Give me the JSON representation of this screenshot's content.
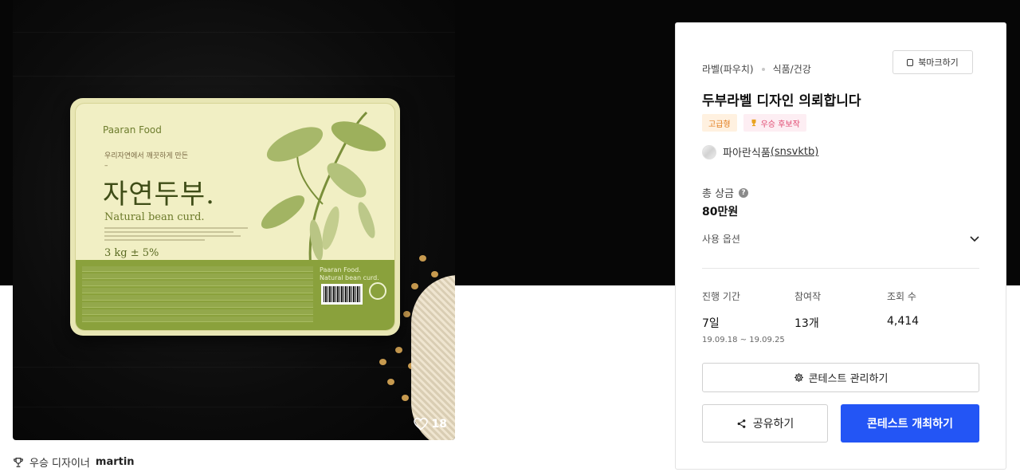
{
  "product_image": {
    "package": {
      "brand": "Paaran Food",
      "subtitle": "우리자연에서 깨끗하게 만든 –",
      "title": "자연두부.",
      "english": "Natural bean curd.",
      "weight": "3 kg ± 5%",
      "band_brand_line1": "Paaran Food.",
      "band_brand_line2": "Natural bean curd."
    },
    "like_count": "18",
    "like_icon": "heart-icon"
  },
  "winner": {
    "icon": "trophy-icon",
    "prefix": "우승 디자이너",
    "name": "martin"
  },
  "card": {
    "categories": [
      "라벨(파우치)",
      "식품/건강"
    ],
    "bookmark_label": "북마크하기",
    "title": "두부라벨 디자인 의뢰합니다",
    "badges": {
      "premium": "고급형",
      "candidate": "우승 후보작"
    },
    "owner": {
      "name": "파아란식품",
      "id": "(snsvktb)"
    },
    "prize": {
      "label": "총 상금",
      "help": "?",
      "value": "80만원"
    },
    "usage_label": "사용 옵션",
    "stats": {
      "period": {
        "label": "진행 기간",
        "value": "7일",
        "dates": "19.09.18 ~ 19.09.25"
      },
      "entries": {
        "label": "참여작",
        "value": "13개"
      },
      "views": {
        "label": "조회 수",
        "value": "4,414"
      }
    },
    "manage_label": "콘테스트 관리하기",
    "share_label": "공유하기",
    "host_label": "콘테스트 개최하기"
  },
  "colors": {
    "primary_button": "#2355f5",
    "hero_background": "#060606",
    "package_green": "#8aa13c"
  }
}
